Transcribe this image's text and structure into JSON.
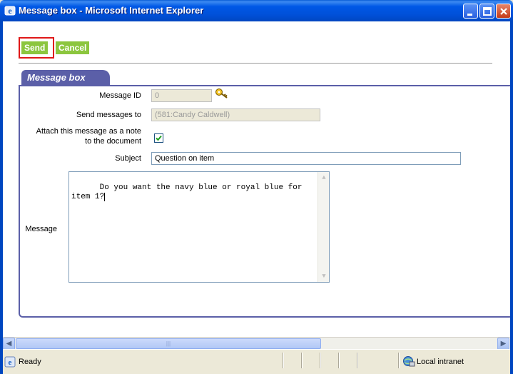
{
  "window": {
    "title": "Message box - Microsoft Internet Explorer",
    "icon": "ie-icon"
  },
  "toolbar": {
    "send_label": "Send",
    "cancel_label": "Cancel"
  },
  "panel": {
    "tab_label": "Message box"
  },
  "form": {
    "message_id_label": "Message ID",
    "message_id_value": "0",
    "send_to_label": "Send messages to",
    "send_to_value": "(581:Candy Caldwell)",
    "attach_label_line1": "Attach this message as a note",
    "attach_label_line2": "to the document",
    "attach_checked": true,
    "subject_label": "Subject",
    "subject_value": "Question on item",
    "message_label": "Message",
    "message_value": "Do you want the navy blue or royal blue for\nitem 1?"
  },
  "statusbar": {
    "ready": "Ready",
    "zone": "Local intranet"
  },
  "colors": {
    "titlebar": "#0058e6",
    "button_green": "#8cc63e",
    "panel_border": "#5b5fa8",
    "highlight": "#e01818"
  }
}
